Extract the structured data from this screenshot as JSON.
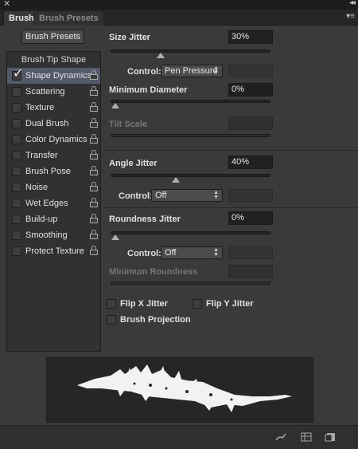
{
  "window": {
    "close_glyph": "✕",
    "collapse_glyph": "◂◂",
    "menu_glyph": "▾≡"
  },
  "tabs": [
    {
      "label": "Brush",
      "active": true
    },
    {
      "label": "Brush Presets",
      "active": false
    }
  ],
  "presets_button": "Brush Presets",
  "sidebar": {
    "header": "Brush Tip Shape",
    "items": [
      {
        "label": "Shape Dynamics",
        "checked": true,
        "selected": true
      },
      {
        "label": "Scattering",
        "checked": false
      },
      {
        "label": "Texture",
        "checked": false
      },
      {
        "label": "Dual Brush",
        "checked": false
      },
      {
        "label": "Color Dynamics",
        "checked": false
      },
      {
        "label": "Transfer",
        "checked": false
      },
      {
        "label": "Brush Pose",
        "checked": false
      },
      {
        "label": "Noise",
        "checked": false
      },
      {
        "label": "Wet Edges",
        "checked": false
      },
      {
        "label": "Build-up",
        "checked": false
      },
      {
        "label": "Smoothing",
        "checked": false
      },
      {
        "label": "Protect Texture",
        "checked": false
      }
    ]
  },
  "size_jitter": {
    "label": "Size Jitter",
    "value": "30%",
    "slider": 0.3
  },
  "size_control": {
    "label": "Control:",
    "value": "Pen Pressure"
  },
  "min_diameter": {
    "label": "Minimum Diameter",
    "value": "0%",
    "slider": 0
  },
  "tilt_scale": {
    "label": "Tilt Scale",
    "value": ""
  },
  "angle_jitter": {
    "label": "Angle Jitter",
    "value": "40%",
    "slider": 0.4
  },
  "angle_control": {
    "label": "Control:",
    "value": "Off"
  },
  "roundness_jitter": {
    "label": "Roundness Jitter",
    "value": "0%",
    "slider": 0
  },
  "roundness_control": {
    "label": "Control:",
    "value": "Off"
  },
  "min_roundness": {
    "label": "Minimum Roundness",
    "value": ""
  },
  "options": {
    "flip_x": "Flip X Jitter",
    "flip_y": "Flip Y Jitter",
    "brush_projection": "Brush Projection"
  },
  "colors": {
    "panel": "#3a3a3a",
    "selected": "#54596a",
    "field": "#202020",
    "stroke": "#f2f2f2"
  }
}
